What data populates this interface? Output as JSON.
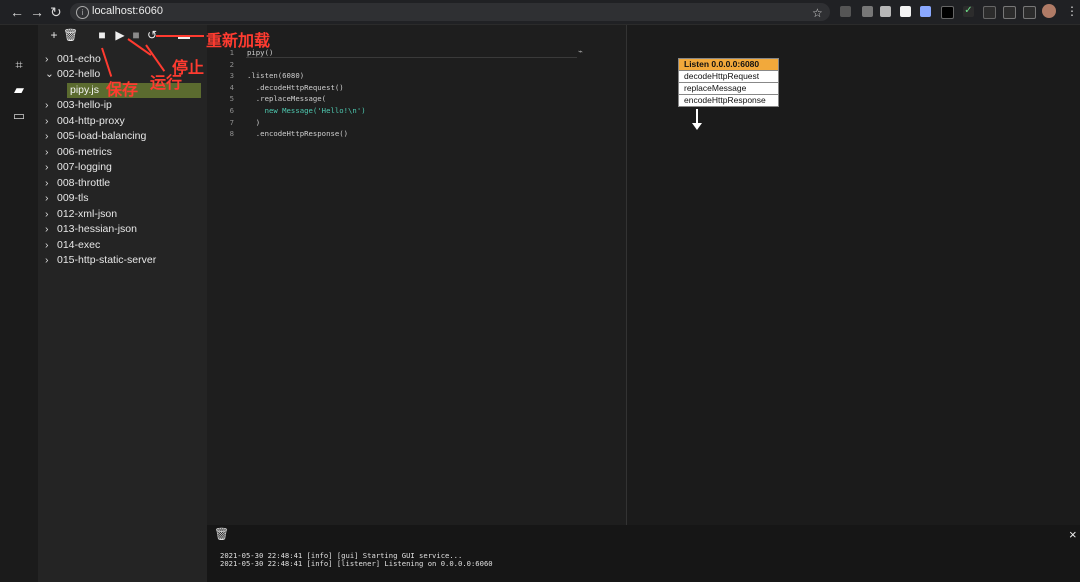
{
  "browser": {
    "url": "localhost:6060"
  },
  "sidebar": {
    "items": [
      {
        "label": "001-echo",
        "expanded": false
      },
      {
        "label": "002-hello",
        "expanded": true
      },
      {
        "label": "003-hello-ip",
        "expanded": false
      },
      {
        "label": "004-http-proxy",
        "expanded": false
      },
      {
        "label": "005-load-balancing",
        "expanded": false
      },
      {
        "label": "006-metrics",
        "expanded": false
      },
      {
        "label": "007-logging",
        "expanded": false
      },
      {
        "label": "008-throttle",
        "expanded": false
      },
      {
        "label": "009-tls",
        "expanded": false
      },
      {
        "label": "012-xml-json",
        "expanded": false
      },
      {
        "label": "013-hessian-json",
        "expanded": false
      },
      {
        "label": "014-exec",
        "expanded": false
      },
      {
        "label": "015-http-static-server",
        "expanded": false
      }
    ],
    "selected_file": "pipy.js"
  },
  "editor": {
    "line_numbers": [
      "1",
      "2",
      "3",
      "4",
      "5",
      "6",
      "7",
      "8"
    ],
    "lines": [
      "pipy()",
      "",
      ".listen(6080)",
      "  .decodeHttpRequest()",
      "  .replaceMessage(",
      "    new Message('Hello!\\n')",
      "  )",
      "  .encodeHttpResponse()"
    ]
  },
  "graph": {
    "title": "Listen 0.0.0.0:6080",
    "items": [
      "decodeHttpRequest",
      "replaceMessage",
      "encodeHttpResponse"
    ]
  },
  "console": {
    "logs": [
      "2021-05-30 22:48:41 [info] [gui] Starting GUI service...",
      "2021-05-30 22:48:41 [info] [listener] Listening on 0.0.0.0:6060"
    ]
  },
  "annotations": {
    "reload": "重新加载",
    "stop": "停止",
    "save": "保存",
    "run": "运行"
  },
  "icons": {
    "back": "left-arrow-icon",
    "forward": "right-arrow-icon",
    "refresh": "refresh-icon"
  }
}
